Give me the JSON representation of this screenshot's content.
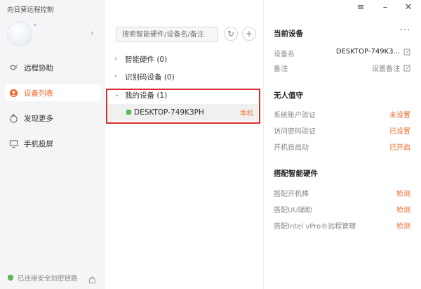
{
  "app": {
    "title": "向日葵远程控制"
  },
  "sidebar": {
    "items": [
      {
        "label": "远程协助",
        "icon": "remote-assist-icon"
      },
      {
        "label": "设备列表",
        "icon": "device-list-icon",
        "active": true
      },
      {
        "label": "发现更多",
        "icon": "discover-icon"
      },
      {
        "label": "手机投屏",
        "icon": "screen-cast-icon"
      }
    ],
    "footer_status": "已连接安全加密链路"
  },
  "search": {
    "placeholder": "搜索智能硬件/设备名/备注"
  },
  "tree": [
    {
      "label": "智能硬件 (0)",
      "expanded": false
    },
    {
      "label": "识别码设备 (0)",
      "expanded": false
    },
    {
      "label": "我的设备 (1)",
      "expanded": true
    }
  ],
  "device": {
    "name": "DESKTOP-749K3PH",
    "tag": "本机",
    "status_color": "#5cb85c"
  },
  "details": {
    "current_device_title": "当前设备",
    "device_name_label": "设备名",
    "device_name_value": "DESKTOP-749K3...",
    "remark_label": "备注",
    "remark_value": "设置备注",
    "unattended_title": "无人值守",
    "rows_unattended": [
      {
        "label": "系统账户验证",
        "value": "未设置"
      },
      {
        "label": "访问密码验证",
        "value": "已设置"
      },
      {
        "label": "开机自启动",
        "value": "已开启"
      }
    ],
    "hardware_title": "搭配智能硬件",
    "rows_hardware": [
      {
        "label": "搭配开机棒",
        "value": "检测"
      },
      {
        "label": "搭配UU辅助",
        "value": "检测"
      },
      {
        "label": "搭配Intel vPro®远程管理",
        "value": "检测"
      }
    ]
  },
  "colors": {
    "accent": "#ef6a2c",
    "highlight": "#d92d2d"
  }
}
